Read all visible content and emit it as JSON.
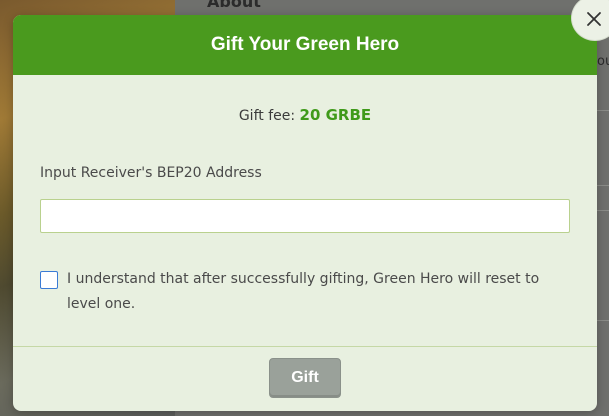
{
  "background": {
    "header_fragment": "About",
    "side_fragment": "ou"
  },
  "modal": {
    "title": "Gift Your Green Hero",
    "fee_label": "Gift fee:",
    "fee_value": "20 GRBE",
    "address_label": "Input Receiver's BEP20 Address",
    "address_value": "",
    "address_placeholder": "",
    "agree_text": "I understand that after successfully gifting, Green Hero will reset to level one.",
    "agree_checked": false,
    "gift_button_label": "Gift"
  },
  "colors": {
    "header_green": "#4a9a1e",
    "fee_green": "#3f9a1a",
    "modal_background": "#e8f0e0",
    "button_disabled": "#9aa19a",
    "checkbox_border": "#3a7bd5"
  },
  "icons": {
    "close": "close-icon"
  }
}
